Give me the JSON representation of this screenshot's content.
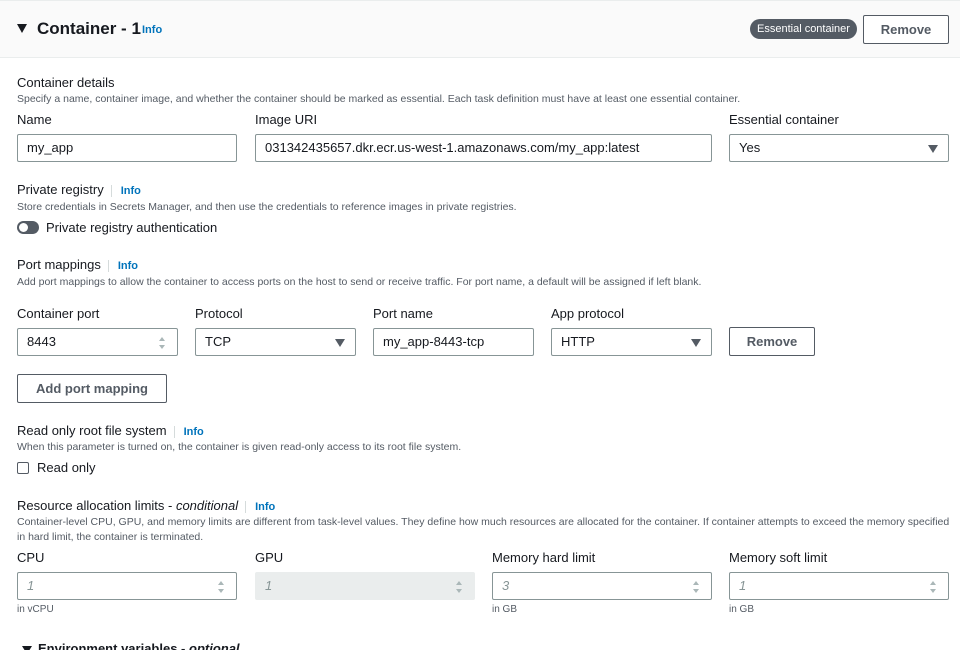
{
  "header": {
    "title": "Container - 1",
    "info": "Info",
    "badge": "Essential container",
    "remove_label": "Remove"
  },
  "container_details": {
    "title": "Container details",
    "description": "Specify a name, container image, and whether the container should be marked as essential. Each task definition must have at least one essential container.",
    "name_label": "Name",
    "name_value": "my_app",
    "image_label": "Image URI",
    "image_value": "031342435657.dkr.ecr.us-west-1.amazonaws.com/my_app:latest",
    "essential_label": "Essential container",
    "essential_value": "Yes"
  },
  "private_registry": {
    "title": "Private registry",
    "info": "Info",
    "description": "Store credentials in Secrets Manager, and then use the credentials to reference images in private registries.",
    "toggle_label": "Private registry authentication"
  },
  "port_mappings": {
    "title": "Port mappings",
    "info": "Info",
    "description": "Add port mappings to allow the container to access ports on the host to send or receive traffic. For port name, a default will be assigned if left blank.",
    "container_port_label": "Container port",
    "container_port_value": "8443",
    "protocol_label": "Protocol",
    "protocol_value": "TCP",
    "port_name_label": "Port name",
    "port_name_value": "my_app-8443-tcp",
    "app_protocol_label": "App protocol",
    "app_protocol_value": "HTTP",
    "remove_label": "Remove",
    "add_label": "Add port mapping"
  },
  "read_only": {
    "title": "Read only root file system",
    "info": "Info",
    "description": "When this parameter is turned on, the container is given read-only access to its root file system.",
    "checkbox_label": "Read only"
  },
  "resources": {
    "title": "Resource allocation limits - ",
    "title_suffix": "conditional",
    "info": "Info",
    "description": "Container-level CPU, GPU, and memory limits are different from task-level values. They define how much resources are allocated for the container. If container attempts to exceed the memory specified in hard limit, the container is terminated.",
    "cpu_label": "CPU",
    "cpu_placeholder": "1",
    "cpu_hint": "in vCPU",
    "gpu_label": "GPU",
    "gpu_placeholder": "1",
    "mem_hard_label": "Memory hard limit",
    "mem_hard_placeholder": "3",
    "mem_hard_hint": "in GB",
    "mem_soft_label": "Memory soft limit",
    "mem_soft_placeholder": "1",
    "mem_soft_hint": "in GB"
  },
  "env_vars": {
    "title": "Environment variables - ",
    "title_suffix": "optional"
  }
}
